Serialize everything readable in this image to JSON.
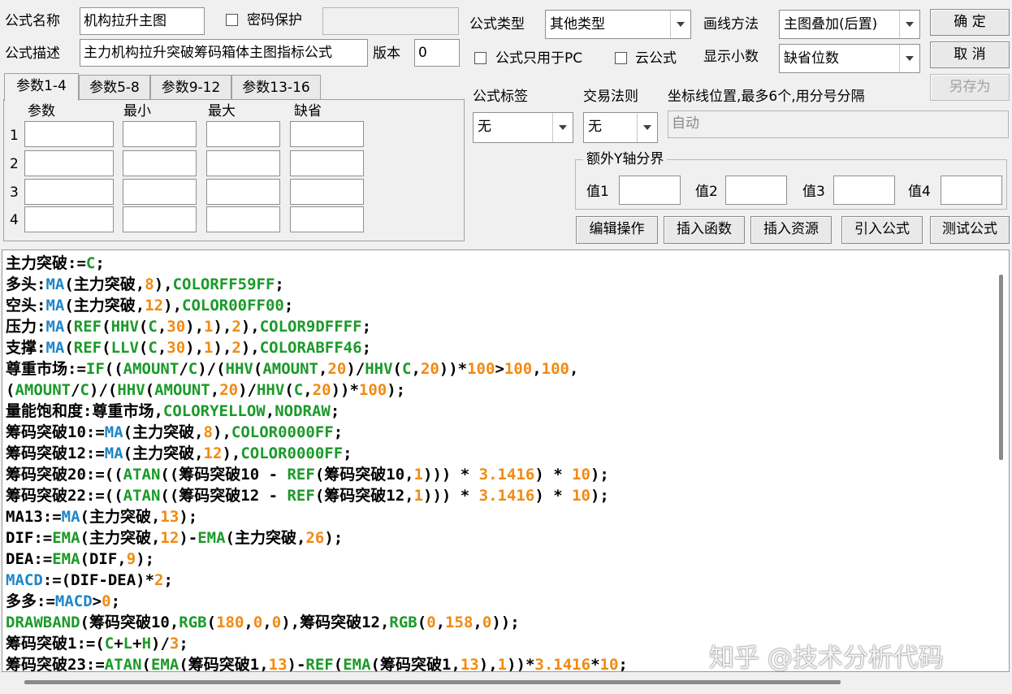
{
  "header": {
    "name_label": "公式名称",
    "name_value": "机构拉升主图",
    "password_label": "密码保护",
    "password_value": "",
    "desc_label": "公式描述",
    "desc_value": "主力机构拉升突破筹码箱体主图指标公式",
    "version_label": "版本",
    "version_value": "0",
    "type_label": "公式类型",
    "type_value": "其他类型",
    "draw_label": "画线方法",
    "draw_value": "主图叠加(后置)",
    "pc_only_label": "公式只用于PC",
    "cloud_label": "云公式",
    "decimals_label": "显示小数",
    "decimals_value": "缺省位数"
  },
  "buttons": {
    "ok": "确  定",
    "cancel": "取  消",
    "save_as": "另存为",
    "edit_ops": "编辑操作",
    "insert_func": "插入函数",
    "insert_res": "插入资源",
    "import_formula": "引入公式",
    "test_formula": "测试公式"
  },
  "tabs": [
    "参数1-4",
    "参数5-8",
    "参数9-12",
    "参数13-16"
  ],
  "params": {
    "col_headers": [
      "参数",
      "最小",
      "最大",
      "缺省"
    ],
    "rows": [
      "1",
      "2",
      "3",
      "4"
    ]
  },
  "tag": {
    "label": "公式标签",
    "value": "无"
  },
  "rule": {
    "label": "交易法则",
    "value": "无"
  },
  "coord": {
    "label": "坐标线位置,最多6个,用分号分隔",
    "value": "自动"
  },
  "yaxis": {
    "title": "额外Y轴分界",
    "labels": [
      "值1",
      "值2",
      "值3",
      "值4"
    ]
  },
  "colors": {
    "black": "#000000",
    "blue": "#1f86c8",
    "green": "#1b9a2a",
    "orange": "#f28a12"
  },
  "code_lines": [
    [
      [
        "主力突破:=",
        "k"
      ],
      [
        "C",
        "g"
      ],
      [
        ";",
        "k"
      ]
    ],
    [
      [
        "多头:",
        "k"
      ],
      [
        "MA",
        "b"
      ],
      [
        "(主力突破,",
        "k"
      ],
      [
        "8",
        "o"
      ],
      [
        "),",
        "k"
      ],
      [
        "COLORFF59FF",
        "g"
      ],
      [
        ";",
        "k"
      ]
    ],
    [
      [
        "空头:",
        "k"
      ],
      [
        "MA",
        "b"
      ],
      [
        "(主力突破,",
        "k"
      ],
      [
        "12",
        "o"
      ],
      [
        "),",
        "k"
      ],
      [
        "COLOR00FF00",
        "g"
      ],
      [
        ";",
        "k"
      ]
    ],
    [
      [
        "压力:",
        "k"
      ],
      [
        "MA",
        "b"
      ],
      [
        "(",
        "k"
      ],
      [
        "REF",
        "g"
      ],
      [
        "(",
        "k"
      ],
      [
        "HHV",
        "g"
      ],
      [
        "(",
        "k"
      ],
      [
        "C",
        "g"
      ],
      [
        ",",
        "k"
      ],
      [
        "30",
        "o"
      ],
      [
        "),",
        "k"
      ],
      [
        "1",
        "o"
      ],
      [
        "),",
        "k"
      ],
      [
        "2",
        "o"
      ],
      [
        "),",
        "k"
      ],
      [
        "COLOR9DFFFF",
        "g"
      ],
      [
        ";",
        "k"
      ]
    ],
    [
      [
        "支撑:",
        "k"
      ],
      [
        "MA",
        "b"
      ],
      [
        "(",
        "k"
      ],
      [
        "REF",
        "g"
      ],
      [
        "(",
        "k"
      ],
      [
        "LLV",
        "g"
      ],
      [
        "(",
        "k"
      ],
      [
        "C",
        "g"
      ],
      [
        ",",
        "k"
      ],
      [
        "30",
        "o"
      ],
      [
        "),",
        "k"
      ],
      [
        "1",
        "o"
      ],
      [
        "),",
        "k"
      ],
      [
        "2",
        "o"
      ],
      [
        "),",
        "k"
      ],
      [
        "COLORABFF46",
        "g"
      ],
      [
        ";",
        "k"
      ]
    ],
    [
      [
        "尊重市场:=",
        "k"
      ],
      [
        "IF",
        "g"
      ],
      [
        "((",
        "k"
      ],
      [
        "AMOUNT",
        "g"
      ],
      [
        "/",
        "k"
      ],
      [
        "C",
        "g"
      ],
      [
        ")/(",
        "k"
      ],
      [
        "HHV",
        "g"
      ],
      [
        "(",
        "k"
      ],
      [
        "AMOUNT",
        "g"
      ],
      [
        ",",
        "k"
      ],
      [
        "20",
        "o"
      ],
      [
        ")/",
        "k"
      ],
      [
        "HHV",
        "g"
      ],
      [
        "(",
        "k"
      ],
      [
        "C",
        "g"
      ],
      [
        ",",
        "k"
      ],
      [
        "20",
        "o"
      ],
      [
        "))*",
        "k"
      ],
      [
        "100",
        "o"
      ],
      [
        ">",
        "k"
      ],
      [
        "100",
        "o"
      ],
      [
        ",",
        "k"
      ],
      [
        "100",
        "o"
      ],
      [
        ",",
        "k"
      ]
    ],
    [
      [
        "(",
        "k"
      ],
      [
        "AMOUNT",
        "g"
      ],
      [
        "/",
        "k"
      ],
      [
        "C",
        "g"
      ],
      [
        ")/(",
        "k"
      ],
      [
        "HHV",
        "g"
      ],
      [
        "(",
        "k"
      ],
      [
        "AMOUNT",
        "g"
      ],
      [
        ",",
        "k"
      ],
      [
        "20",
        "o"
      ],
      [
        ")/",
        "k"
      ],
      [
        "HHV",
        "g"
      ],
      [
        "(",
        "k"
      ],
      [
        "C",
        "g"
      ],
      [
        ",",
        "k"
      ],
      [
        "20",
        "o"
      ],
      [
        "))*",
        "k"
      ],
      [
        "100",
        "o"
      ],
      [
        ");",
        "k"
      ]
    ],
    [
      [
        "量能饱和度:尊重市场,",
        "k"
      ],
      [
        "COLORYELLOW",
        "g"
      ],
      [
        ",",
        "k"
      ],
      [
        "NODRAW",
        "g"
      ],
      [
        ";",
        "k"
      ]
    ],
    [
      [
        "筹码突破10:=",
        "k"
      ],
      [
        "MA",
        "b"
      ],
      [
        "(主力突破,",
        "k"
      ],
      [
        "8",
        "o"
      ],
      [
        "),",
        "k"
      ],
      [
        "COLOR0000FF",
        "g"
      ],
      [
        ";",
        "k"
      ]
    ],
    [
      [
        "筹码突破12:=",
        "k"
      ],
      [
        "MA",
        "b"
      ],
      [
        "(主力突破,",
        "k"
      ],
      [
        "12",
        "o"
      ],
      [
        "),",
        "k"
      ],
      [
        "COLOR0000FF",
        "g"
      ],
      [
        ";",
        "k"
      ]
    ],
    [
      [
        "筹码突破20:=((",
        "k"
      ],
      [
        "ATAN",
        "g"
      ],
      [
        "((筹码突破10 - ",
        "k"
      ],
      [
        "REF",
        "g"
      ],
      [
        "(筹码突破10,",
        "k"
      ],
      [
        "1",
        "o"
      ],
      [
        "))) * ",
        "k"
      ],
      [
        "3.1416",
        "o"
      ],
      [
        ") * ",
        "k"
      ],
      [
        "10",
        "o"
      ],
      [
        ");",
        "k"
      ]
    ],
    [
      [
        "筹码突破22:=((",
        "k"
      ],
      [
        "ATAN",
        "g"
      ],
      [
        "((筹码突破12 - ",
        "k"
      ],
      [
        "REF",
        "g"
      ],
      [
        "(筹码突破12,",
        "k"
      ],
      [
        "1",
        "o"
      ],
      [
        "))) * ",
        "k"
      ],
      [
        "3.1416",
        "o"
      ],
      [
        ") * ",
        "k"
      ],
      [
        "10",
        "o"
      ],
      [
        ");",
        "k"
      ]
    ],
    [
      [
        "MA13:=",
        "k"
      ],
      [
        "MA",
        "b"
      ],
      [
        "(主力突破,",
        "k"
      ],
      [
        "13",
        "o"
      ],
      [
        ");",
        "k"
      ]
    ],
    [
      [
        "DIF:=",
        "k"
      ],
      [
        "EMA",
        "g"
      ],
      [
        "(主力突破,",
        "k"
      ],
      [
        "12",
        "o"
      ],
      [
        ")-",
        "k"
      ],
      [
        "EMA",
        "g"
      ],
      [
        "(主力突破,",
        "k"
      ],
      [
        "26",
        "o"
      ],
      [
        ");",
        "k"
      ]
    ],
    [
      [
        "DEA:=",
        "k"
      ],
      [
        "EMA",
        "g"
      ],
      [
        "(DIF,",
        "k"
      ],
      [
        "9",
        "o"
      ],
      [
        ");",
        "k"
      ]
    ],
    [
      [
        "MACD",
        "b"
      ],
      [
        ":=(DIF-DEA)*",
        "k"
      ],
      [
        "2",
        "o"
      ],
      [
        ";",
        "k"
      ]
    ],
    [
      [
        "多多:=",
        "k"
      ],
      [
        "MACD",
        "b"
      ],
      [
        ">",
        "k"
      ],
      [
        "0",
        "o"
      ],
      [
        ";",
        "k"
      ]
    ],
    [
      [
        "DRAWBAND",
        "g"
      ],
      [
        "(筹码突破10,",
        "k"
      ],
      [
        "RGB",
        "g"
      ],
      [
        "(",
        "k"
      ],
      [
        "180",
        "o"
      ],
      [
        ",",
        "k"
      ],
      [
        "0",
        "o"
      ],
      [
        ",",
        "k"
      ],
      [
        "0",
        "o"
      ],
      [
        "),筹码突破12,",
        "k"
      ],
      [
        "RGB",
        "g"
      ],
      [
        "(",
        "k"
      ],
      [
        "0",
        "o"
      ],
      [
        ",",
        "k"
      ],
      [
        "158",
        "o"
      ],
      [
        ",",
        "k"
      ],
      [
        "0",
        "o"
      ],
      [
        "));",
        "k"
      ]
    ],
    [
      [
        "筹码突破1:=(",
        "k"
      ],
      [
        "C",
        "g"
      ],
      [
        "+",
        "k"
      ],
      [
        "L",
        "g"
      ],
      [
        "+",
        "k"
      ],
      [
        "H",
        "g"
      ],
      [
        ")/",
        "k"
      ],
      [
        "3",
        "o"
      ],
      [
        ";",
        "k"
      ]
    ],
    [
      [
        "筹码突破23:=",
        "k"
      ],
      [
        "ATAN",
        "g"
      ],
      [
        "(",
        "k"
      ],
      [
        "EMA",
        "g"
      ],
      [
        "(筹码突破1,",
        "k"
      ],
      [
        "13",
        "o"
      ],
      [
        ")-",
        "k"
      ],
      [
        "REF",
        "g"
      ],
      [
        "(",
        "k"
      ],
      [
        "EMA",
        "g"
      ],
      [
        "(筹码突破1,",
        "k"
      ],
      [
        "13",
        "o"
      ],
      [
        "),",
        "k"
      ],
      [
        "1",
        "o"
      ],
      [
        "))*",
        "k"
      ],
      [
        "3.1416",
        "o"
      ],
      [
        "*",
        "k"
      ],
      [
        "10",
        "o"
      ],
      [
        ";",
        "k"
      ]
    ]
  ],
  "watermark": "知乎 @技术分析代码"
}
